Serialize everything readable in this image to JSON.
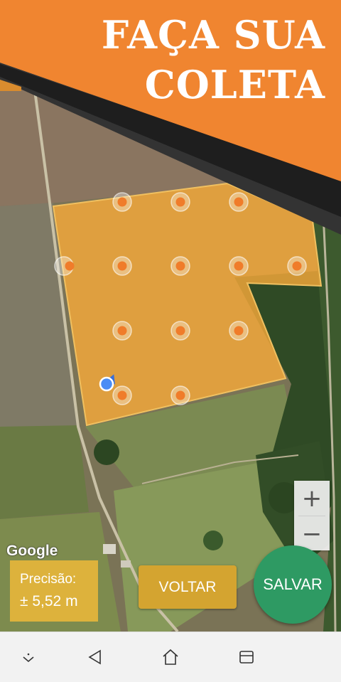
{
  "banner": {
    "line1": "FAÇA SUA",
    "line2": "COLETA",
    "color": "#f08530"
  },
  "map": {
    "attribution": "Google",
    "zoom_in_label": "+",
    "zoom_out_label": "−",
    "polygon_color": "#f5a83a",
    "sample_point_color": "#f07c2a",
    "location_dot_color": "#4a8df5"
  },
  "precision": {
    "label": "Precisão:",
    "value": "±  5,52 m"
  },
  "actions": {
    "back_label": "VOLTAR",
    "save_label": "SALVAR"
  },
  "navbar": {
    "icons": [
      "keyboard-hide-icon",
      "back-triangle-icon",
      "home-icon",
      "recents-icon"
    ]
  }
}
